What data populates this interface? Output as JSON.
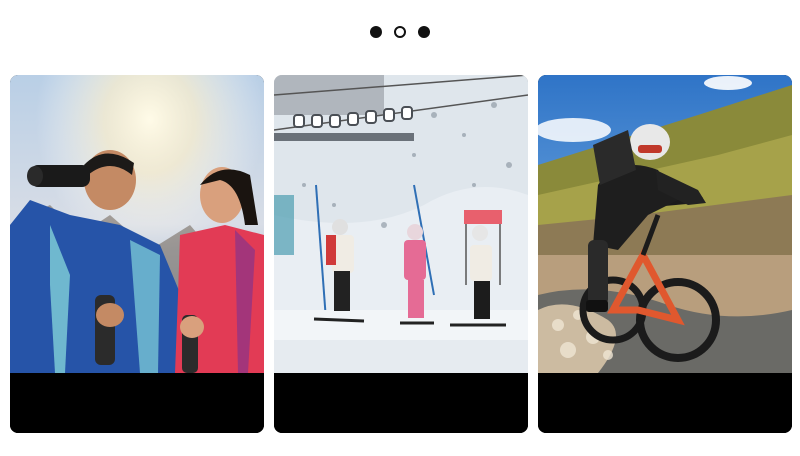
{
  "carousel": {
    "pages": [
      {
        "state": "inactive"
      },
      {
        "state": "active"
      },
      {
        "state": "inactive"
      }
    ]
  },
  "cards": [
    {
      "scene": "hikers-with-binoculars",
      "caption": ""
    },
    {
      "scene": "skiers-on-slope",
      "caption": ""
    },
    {
      "scene": "mountain-biker-in-water",
      "caption": ""
    }
  ],
  "colors": {
    "background": "#ffffff",
    "dot": "#111111",
    "caption_bar": "#000000"
  }
}
